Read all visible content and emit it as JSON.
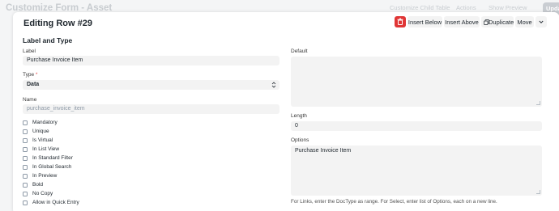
{
  "topbar": {
    "page_title": "Customize Form - Asset",
    "btn_child_table": "Customize Child Table",
    "btn_actions": "Actions",
    "btn_show_preview": "Show Preview",
    "btn_update": "Updat"
  },
  "dialog": {
    "title": "Editing Row #29",
    "delete_icon": "trash-icon",
    "btn_insert_below": "Insert Below",
    "btn_insert_above": "Insert Above",
    "btn_duplicate": "Duplicate",
    "btn_move": "Move",
    "collapse_icon": "chevron-down-icon"
  },
  "section": {
    "label": "Label and Type"
  },
  "fields": {
    "label": {
      "label": "Label",
      "value": "Purchase Invoice Item"
    },
    "type": {
      "label": "Type",
      "required_mark": "*",
      "value": "Data"
    },
    "name": {
      "label": "Name",
      "value": "purchase_invoice_item"
    },
    "default": {
      "label": "Default",
      "value": ""
    },
    "length": {
      "label": "Length",
      "value": "0"
    },
    "options": {
      "label": "Options",
      "value": "Purchase Invoice Item",
      "help": "For Links, enter the DocType as range. For Select, enter list of Options, each on a new line."
    }
  },
  "checkboxes": [
    {
      "label": "Mandatory",
      "checked": false
    },
    {
      "label": "Unique",
      "checked": false
    },
    {
      "label": "Is Virtual",
      "checked": false
    },
    {
      "label": "In List View",
      "checked": false
    },
    {
      "label": "In Standard Filter",
      "checked": false
    },
    {
      "label": "In Global Search",
      "checked": false
    },
    {
      "label": "In Preview",
      "checked": false
    },
    {
      "label": "Bold",
      "checked": false
    },
    {
      "label": "No Copy",
      "checked": false
    },
    {
      "label": "Allow in Quick Entry",
      "checked": false
    }
  ],
  "colors": {
    "delete_red": "#e03636",
    "input_bg": "#f3f3f3",
    "required_red": "#e24c4c"
  }
}
